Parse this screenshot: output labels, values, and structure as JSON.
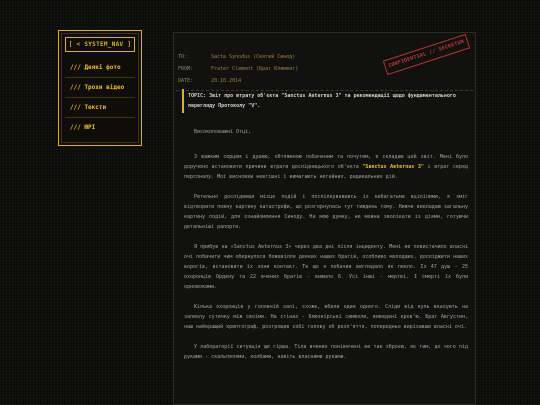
{
  "sidebar": {
    "title": "[ < SYSTEM_NAV ]",
    "items": [
      {
        "label": "/// Деякі фото"
      },
      {
        "label": "/// Трохи відео"
      },
      {
        "label": "/// Тексти"
      },
      {
        "label": "/// ЮРІ"
      }
    ]
  },
  "doc": {
    "meta": {
      "to_key": "TO:",
      "to_value": "Sacta Synodus (Святий Синод)",
      "from_key": "FROM:",
      "from_value": "Frater Clement (Брат Климент)",
      "date_key": "DATE:",
      "date_value": "20.10.2014"
    },
    "stamp": "CONFIDENTIAL // SECRETUM",
    "topic": "TOPIC: Звіт про втрату об'єкта \"Sanctus Aeternus 3\" та рекомендації щодо фундаментального перегляду Протоколу \"V\".",
    "greeting": "Високоповажні Отці,",
    "p1_a": "З важким серцем і душею, обтяженою побаченим та почутим, я складаю цей звіт. Мені було доручено встановити причини втрати дослідницького об'єкта ",
    "p1_hl": "\"Sanctus Aeternus 3\"",
    "p1_b": " і втрат серед персоналу. Мої висновки невтішні і вимагають негайних, радикальних дій.",
    "p2": "Ретельно дослідивши місце подій і поспілкувавшись із небагатьма вцілілими, я зміг відтворити повну картину катастрофи, що розгорнулась тут тиждень тому. Нижче викладаю загальну картину подій, для ознайомлення Синоду. На мою думку, не можна зволікати із діями, готуючи детальніші рапорти.",
    "p3": "Я прибув на «Sanctus Aeternus 3» через два дні після інциденту. Мені не повистачило власні очі побачити чим обернулося божевілля деяких наших братів, особливо молодших, досліджити наших ворогів, встановити їх зони контакт. Те що я побачив виглядало як пекло. Із 47 душ - 25 охоронців Ордену та 22 вчених братів - вижило 6. Усі інші - мертві. І смерті їх були одновокими.",
    "p4": "Кілька охоронців у головній залі, схоже, вбили один одного. Сліди від куль вказують на запеклу сутичку між своїми. На стінах - блюзнірські символи, виведені кров'ю. Брат Августин, наш найкращий криптограф, розтрощив собі голову об розп'яття, попередньо вирізавши власні очі.",
    "p5": "У лабораторії ситуація ще гірша. Тіла вчених понівечені не так зброєю, як тим, до чого під руками - скальпелями, колбами, навіть власними руками."
  }
}
